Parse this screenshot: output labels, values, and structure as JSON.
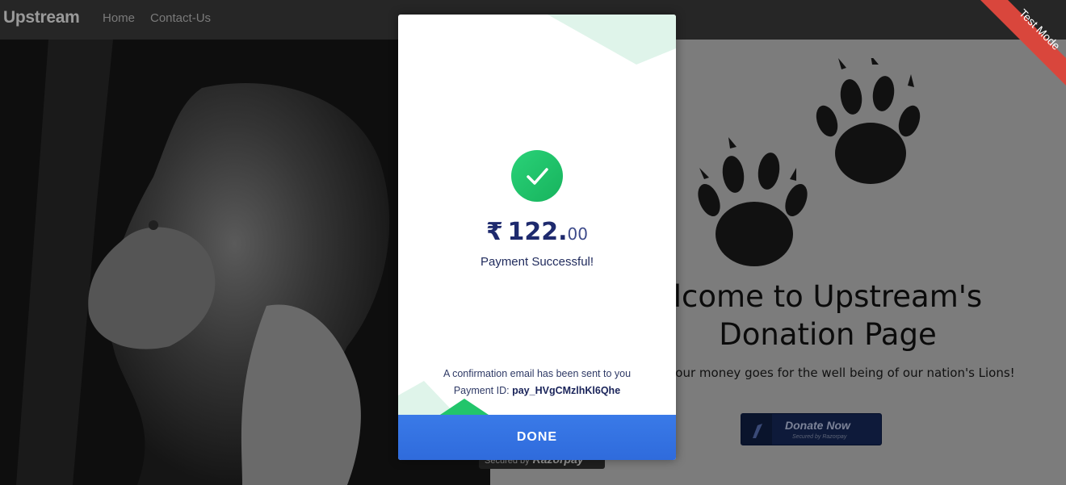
{
  "navbar": {
    "brand": "Upstream",
    "links": [
      "Home",
      "Contact-Us"
    ]
  },
  "ribbon": {
    "label": "Test Mode",
    "color": "#d9463c"
  },
  "page": {
    "welcome": "lcome to Upstream's Donation Page",
    "tagline": "ure, your money goes for the well being of our nation's Lions!",
    "donate_button": {
      "label": "Donate Now",
      "sub_label": "Secured by Razorpay"
    },
    "secured_tag": {
      "prefix": "Secured by",
      "brand": "Razorpay"
    }
  },
  "modal": {
    "currency_symbol": "₹",
    "amount_whole": "122.",
    "amount_decimal": "00",
    "status": "Payment Successful!",
    "confirmation": "A confirmation email has been sent to you",
    "payment_id_label": "Payment ID:",
    "payment_id": "pay_HVgCMzlhKl6Qhe",
    "done_label": "DONE",
    "accent_color": "#2f6bdc",
    "success_color": "#22c56b"
  }
}
